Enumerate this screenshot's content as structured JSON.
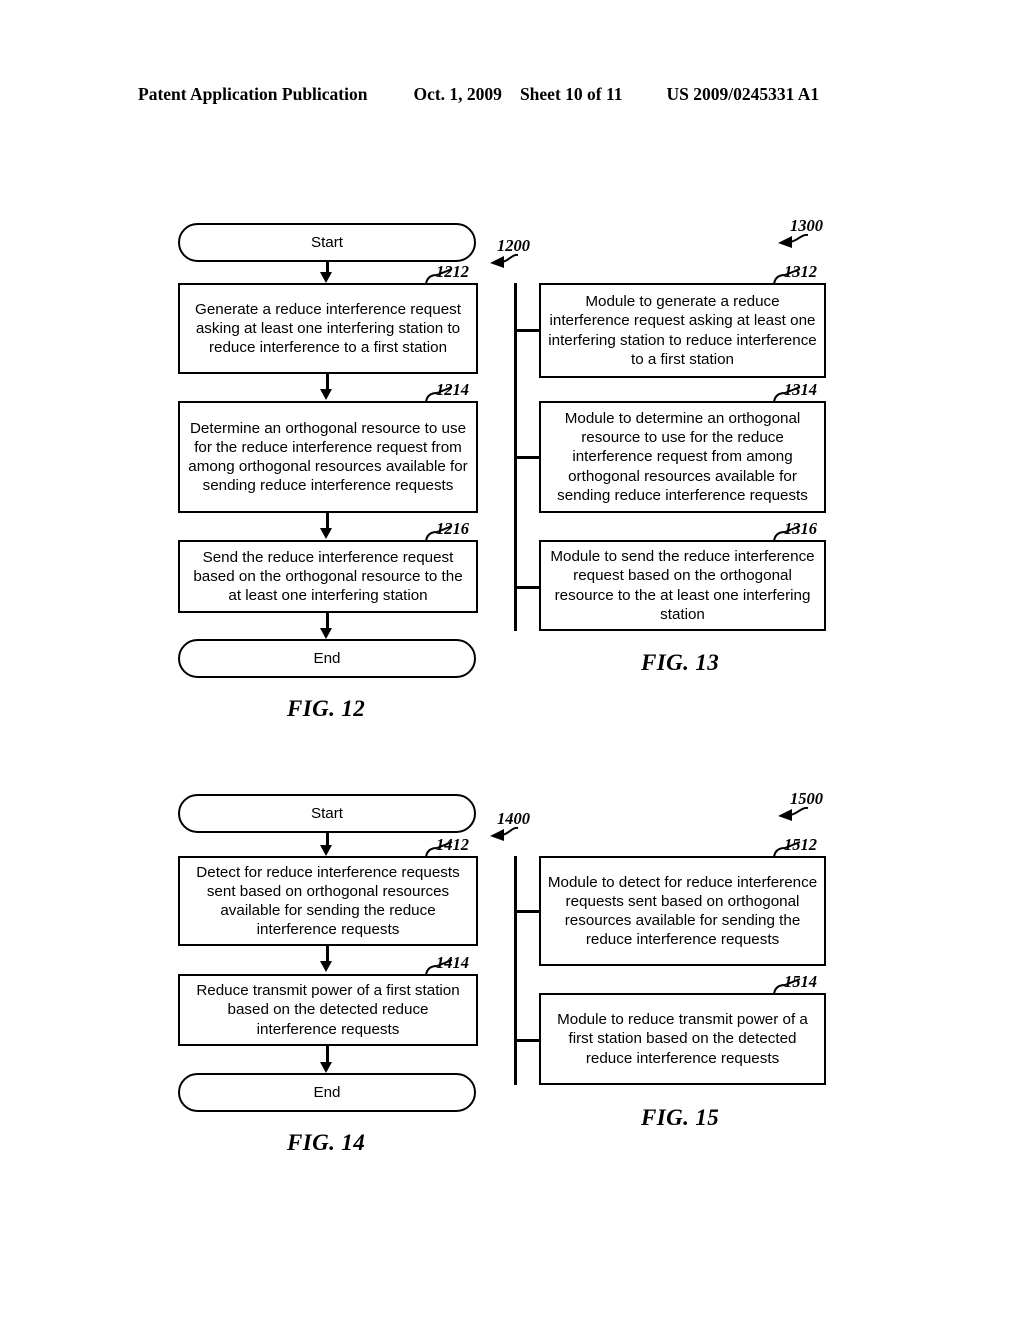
{
  "header": {
    "publication": "Patent Application Publication",
    "date": "Oct. 1, 2009",
    "sheet": "Sheet 10 of 11",
    "patent_number": "US 2009/0245331 A1"
  },
  "figures": [
    {
      "id": "fig12",
      "caption": "FIG. 12",
      "apparatus_ref": "1200",
      "type": "flowchart",
      "nodes": [
        {
          "ref": "",
          "shape": "terminator",
          "text": "Start"
        },
        {
          "ref": "1212",
          "shape": "process",
          "text": "Generate a reduce interference request asking at least one interfering station to reduce interference to a first station"
        },
        {
          "ref": "1214",
          "shape": "process",
          "text": "Determine an orthogonal resource to use for the reduce interference request from among orthogonal resources available for sending reduce interference requests"
        },
        {
          "ref": "1216",
          "shape": "process",
          "text": "Send the reduce interference request based on the orthogonal resource to the at least one interfering station"
        },
        {
          "ref": "",
          "shape": "terminator",
          "text": "End"
        }
      ]
    },
    {
      "id": "fig13",
      "caption": "FIG. 13",
      "apparatus_ref": "1300",
      "type": "module-block",
      "nodes": [
        {
          "ref": "1312",
          "shape": "module",
          "text": "Module to generate a reduce interference request asking at least one interfering station to reduce interference to a first station"
        },
        {
          "ref": "1314",
          "shape": "module",
          "text": "Module to determine an orthogonal resource to use for the reduce interference request from among orthogonal resources available for sending reduce interference requests"
        },
        {
          "ref": "1316",
          "shape": "module",
          "text": "Module to send the reduce interference request based on the orthogonal resource to the at least one interfering station"
        }
      ]
    },
    {
      "id": "fig14",
      "caption": "FIG. 14",
      "apparatus_ref": "1400",
      "type": "flowchart",
      "nodes": [
        {
          "ref": "",
          "shape": "terminator",
          "text": "Start"
        },
        {
          "ref": "1412",
          "shape": "process",
          "text": "Detect for reduce interference requests sent based on orthogonal resources available for sending the reduce interference requests"
        },
        {
          "ref": "1414",
          "shape": "process",
          "text": "Reduce transmit power of a first station based on the detected reduce interference requests"
        },
        {
          "ref": "",
          "shape": "terminator",
          "text": "End"
        }
      ]
    },
    {
      "id": "fig15",
      "caption": "FIG. 15",
      "apparatus_ref": "1500",
      "type": "module-block",
      "nodes": [
        {
          "ref": "1512",
          "shape": "module",
          "text": "Module to detect for reduce interference requests sent based on orthogonal resources available for sending the reduce interference requests"
        },
        {
          "ref": "1514",
          "shape": "module",
          "text": "Module to reduce transmit power of a first station based on the detected reduce interference requests"
        }
      ]
    }
  ],
  "colors": {
    "ink": "#000000",
    "paper": "#ffffff"
  }
}
